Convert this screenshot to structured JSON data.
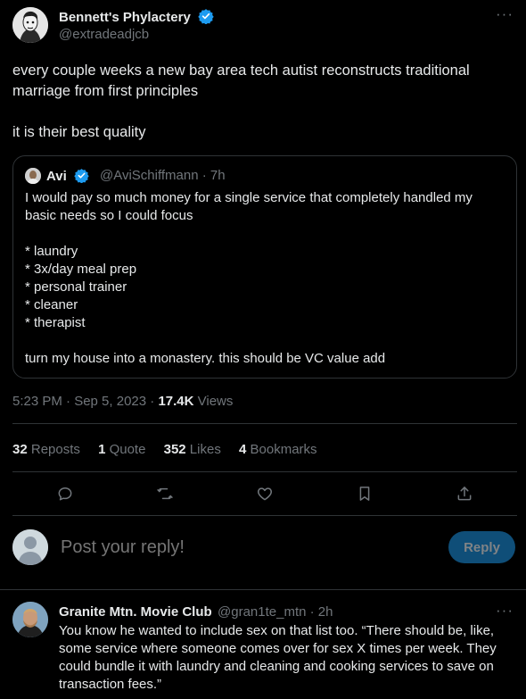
{
  "tweet": {
    "author_name": "Bennett's Phylactery",
    "author_handle": "@extradeadjcb",
    "more_label": "···",
    "text": [
      "every couple weeks a new bay area tech autist reconstructs traditional marriage from first principles",
      "it is their best quality"
    ],
    "timestamp": "5:23 PM · Sep 5, 2023 · ",
    "views_count": "17.4K",
    "views_label": " Views"
  },
  "quote": {
    "author_name": "Avi",
    "author_handle": "@AviSchiffmann · 7h",
    "lines": [
      "I would pay so much money for a single service that completely handled my",
      "basic needs so I could focus",
      "",
      "* laundry",
      "* 3x/day meal prep",
      "* personal trainer",
      "* cleaner",
      "* therapist",
      "",
      "turn my house into a monastery. this should be VC value add"
    ]
  },
  "stats": {
    "reposts_count": "32",
    "reposts_label": " Reposts",
    "quotes_count": "1",
    "quotes_label": " Quote",
    "likes_count": "352",
    "likes_label": " Likes",
    "bookmarks_count": "4",
    "bookmarks_label": " Bookmarks"
  },
  "actions": [
    "reply-icon",
    "repost-icon",
    "like-icon",
    "bookmark-icon",
    "share-icon"
  ],
  "composer": {
    "placeholder": "Post your reply!",
    "reply_button": "Reply"
  },
  "reply": {
    "author_name": "Granite Mtn. Movie Club",
    "author_handle": "@gran1te_mtn · 2h",
    "more_label": "···",
    "text": "You know he wanted to include sex on that list too. “There should be, like, some service where someone comes over for sex X times per week. They could bundle it with laundry and cleaning and cooking services to save on transaction fees.”"
  },
  "colors": {
    "background": "#000000",
    "text": "#e7e9ea",
    "muted": "#71767b",
    "verified": "#1d9bf0",
    "reply_button": "#0f4e78",
    "divider": "#2f3336"
  }
}
